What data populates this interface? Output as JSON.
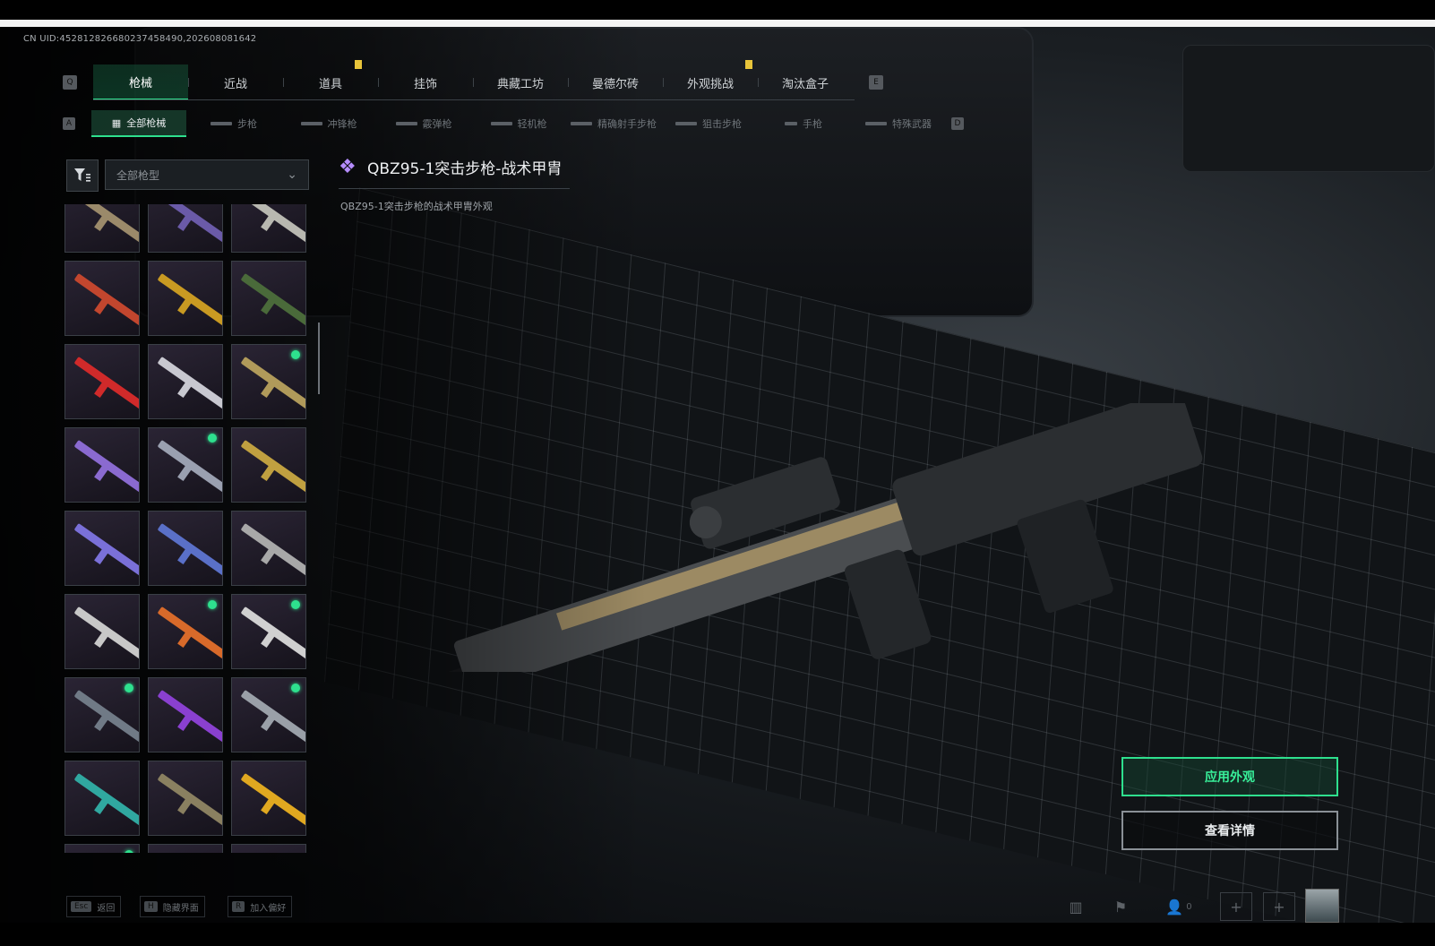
{
  "uid": "CN UID:452812826680237458490,202608081642",
  "tabs": [
    {
      "label": "枪械",
      "active": true
    },
    {
      "label": "近战"
    },
    {
      "label": "道具",
      "badge": true
    },
    {
      "label": "挂饰"
    },
    {
      "label": "典藏工坊"
    },
    {
      "label": "曼德尔砖"
    },
    {
      "label": "外观挑战",
      "badge": true
    },
    {
      "label": "淘汰盒子"
    }
  ],
  "tab_prev_key": "Q",
  "tab_next_key": "E",
  "subtabs": [
    {
      "label": "全部枪械",
      "active": true
    },
    {
      "label": "步枪"
    },
    {
      "label": "冲锋枪"
    },
    {
      "label": "霰弹枪"
    },
    {
      "label": "轻机枪"
    },
    {
      "label": "精确射手步枪"
    },
    {
      "label": "狙击步枪"
    },
    {
      "label": "手枪"
    },
    {
      "label": "特殊武器"
    }
  ],
  "subtab_prev_key": "A",
  "subtab_next_key": "D",
  "filter": {
    "selected": "全部枪型"
  },
  "weapon": {
    "title": "QBZ95-1突击步枪-战术甲胄",
    "description": "QBZ95-1突击步枪的战术甲胄外观"
  },
  "actions": {
    "apply": "应用外观",
    "details": "查看详情"
  },
  "footer": {
    "hints": [
      {
        "key": "Esc",
        "label": "返回"
      },
      {
        "key": "H",
        "label": "隐藏界面"
      },
      {
        "key": "R",
        "label": "加入偏好"
      }
    ],
    "party_count": "0"
  },
  "colors": {
    "accent": "#2ee08e",
    "badge": "#e8c43a",
    "rarity": "#b58cff"
  },
  "skins": [
    {
      "c": "#9b8a6a",
      "dot": false
    },
    {
      "c": "#6a5aa8",
      "dot": false
    },
    {
      "c": "#b8b8b0",
      "dot": false
    },
    {
      "c": "#c2462e",
      "dot": false
    },
    {
      "c": "#c99a22",
      "dot": false
    },
    {
      "c": "#4a6a3a",
      "dot": false
    },
    {
      "c": "#d02a2a",
      "dot": false
    },
    {
      "c": "#c8c8d0",
      "dot": false
    },
    {
      "c": "#b09a5a",
      "dot": true
    },
    {
      "c": "#8a6ad0",
      "dot": false
    },
    {
      "c": "#9aa0b0",
      "dot": true
    },
    {
      "c": "#c0a040",
      "dot": false
    },
    {
      "c": "#7a70d8",
      "dot": false
    },
    {
      "c": "#5a70c8",
      "dot": false
    },
    {
      "c": "#a8a8a8",
      "dot": false
    },
    {
      "c": "#c8c8c8",
      "dot": false
    },
    {
      "c": "#d86a2a",
      "dot": true
    },
    {
      "c": "#d0d0d0",
      "dot": true
    },
    {
      "c": "#707a86",
      "dot": true
    },
    {
      "c": "#8a40d0",
      "dot": false
    },
    {
      "c": "#9aa0a8",
      "dot": true
    },
    {
      "c": "#30a8a0",
      "dot": false
    },
    {
      "c": "#8a8060",
      "dot": false
    },
    {
      "c": "#e0a820",
      "dot": false
    },
    {
      "c": "#8a8a8a",
      "dot": true
    },
    {
      "c": "#9a9a9a",
      "dot": false
    },
    {
      "c": "#8a8a8a",
      "dot": false
    }
  ]
}
